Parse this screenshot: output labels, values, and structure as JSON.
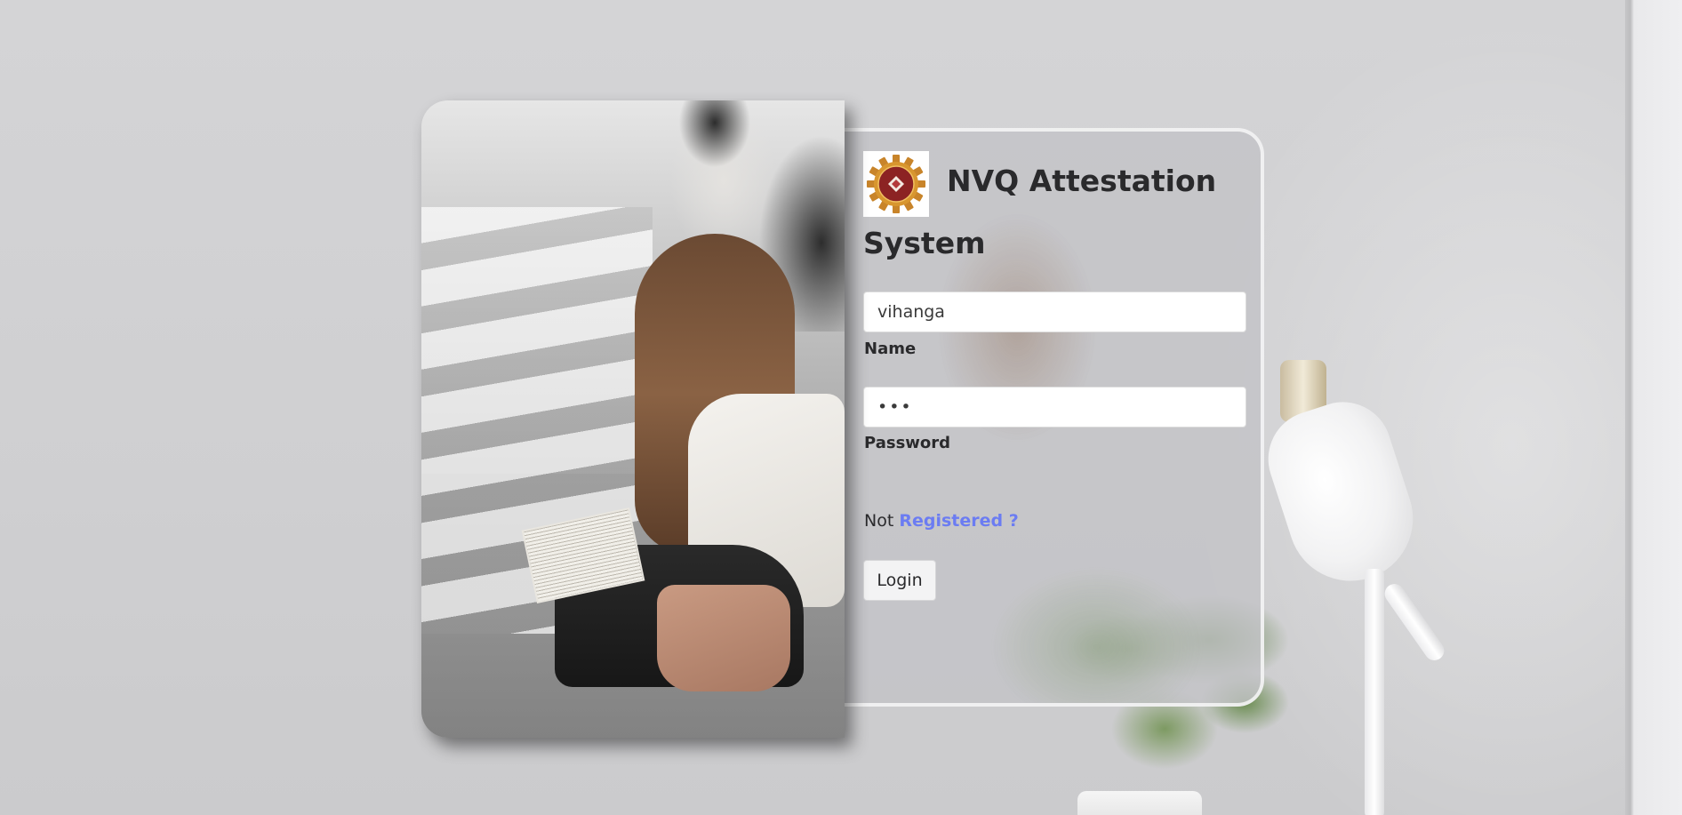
{
  "app": {
    "title_line1": "NVQ Attestation",
    "title_line2": "System",
    "logo_icon": "gear-emblem-logo"
  },
  "form": {
    "name_value": "vihanga",
    "name_label": "Name",
    "password_value": "•••",
    "password_label": "Password",
    "register_prefix": "Not",
    "register_link": "Registered ?",
    "login_button": "Login"
  },
  "colors": {
    "link": "#6b7cf2",
    "title_text": "#2a2a2c",
    "panel_bg": "#c3c3c7"
  }
}
